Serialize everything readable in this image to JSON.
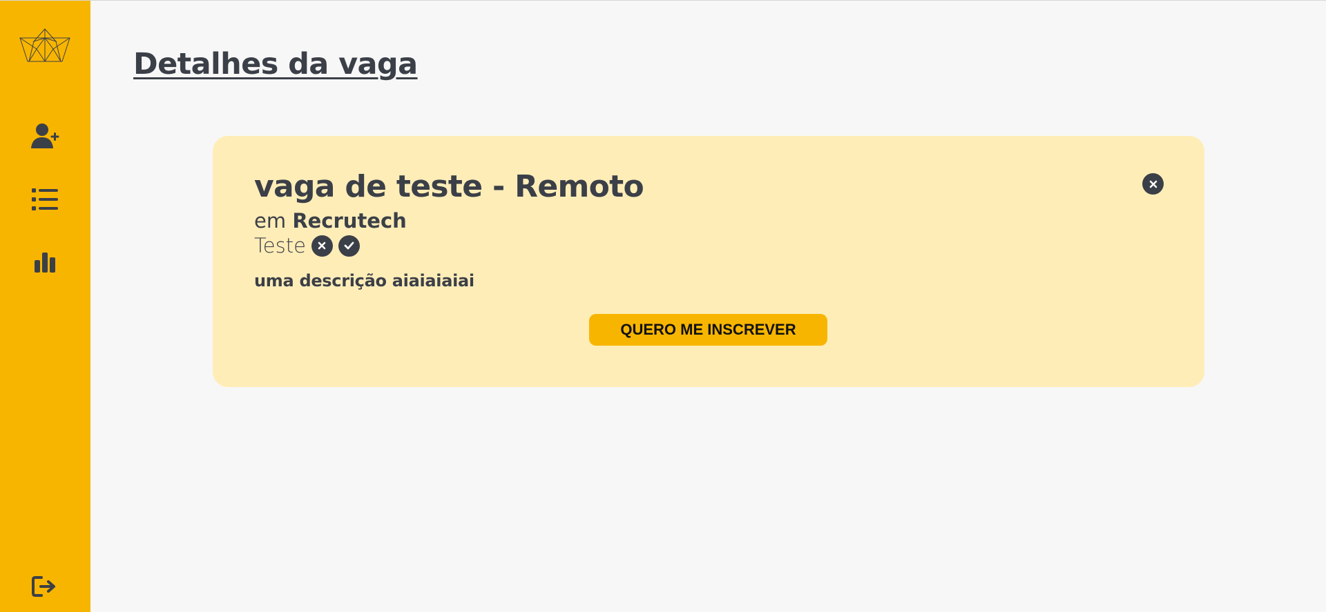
{
  "page": {
    "title": "Detalhes da vaga"
  },
  "sidebar": {
    "logo_icon": "origami-logo-icon",
    "items": [
      {
        "icon": "user-plus-icon"
      },
      {
        "icon": "list-icon"
      },
      {
        "icon": "bar-chart-icon"
      }
    ],
    "logout_icon": "logout-icon"
  },
  "job": {
    "title": "vaga de teste - Remoto",
    "company_prefix": "em",
    "company": "Recrutech",
    "location": "Teste",
    "description": "uma descrição aiaiaiaiai",
    "apply_label": "QUERO ME INSCREVER",
    "close_icon": "close-icon",
    "reject_icon": "x-circle-icon",
    "accept_icon": "check-circle-icon"
  },
  "colors": {
    "sidebar": "#F8B500",
    "page_background": "#F7F7F7",
    "card_background": "#FFEDB8",
    "text": "#3B3F47",
    "button": "#F8B500"
  }
}
